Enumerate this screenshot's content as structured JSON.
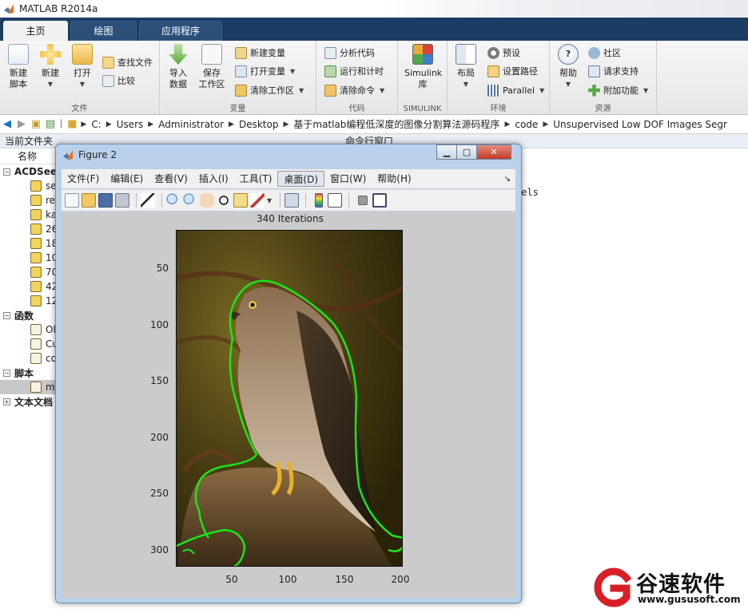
{
  "app": {
    "title": "MATLAB R2014a"
  },
  "tabs": [
    {
      "label": "主页"
    },
    {
      "label": "绘图"
    },
    {
      "label": "应用程序"
    }
  ],
  "ribbon": {
    "file_group": {
      "label": "文件",
      "new_script": "新建\n脚本",
      "new": "新建",
      "open": "打开",
      "find_files": "查找文件",
      "compare": "比较"
    },
    "variable_group": {
      "label": "变量",
      "import_data": "导入\n数据",
      "save_workspace": "保存\n工作区",
      "new_variable": "新建变量",
      "open_variable": "打开变量",
      "clear_workspace": "清除工作区"
    },
    "code_group": {
      "label": "代码",
      "analyze_code": "分析代码",
      "run_and_time": "运行和计时",
      "clear_commands": "清除命令"
    },
    "simulink_group": {
      "label": "SIMULINK",
      "simulink_library": "Simulink\n库"
    },
    "env_group": {
      "label": "环境",
      "layout": "布局",
      "preferences": "预设",
      "set_path": "设置路径",
      "parallel": "Parallel"
    },
    "resources_group": {
      "label": "资源",
      "help": "帮助",
      "community": "社区",
      "request_support": "请求支持",
      "add_ons": "附加功能"
    }
  },
  "address": {
    "crumbs": [
      "C:",
      "Users",
      "Administrator",
      "Desktop",
      "基于matlab编程低深度的图像分割算法源码程序",
      "code",
      "Unsupervised Low DOF Images Segr"
    ]
  },
  "current_folder": {
    "title": "当前文件夹",
    "column_name": "名称",
    "acdsee_group": "ACDSee",
    "acdsee_items": [
      "se",
      "re",
      "ka",
      "26",
      "18",
      "10",
      "70",
      "42",
      "12"
    ],
    "function_group": "函数",
    "function_items": [
      "Ol",
      "Cu",
      "co"
    ],
    "script_group": "脚本",
    "script_items": [
      "m"
    ],
    "text_group": "文本文档"
  },
  "command_window": {
    "title": "命令行窗口",
    "visible_text": "xels"
  },
  "figure": {
    "title": "Figure 2",
    "menus": [
      "文件(F)",
      "编辑(E)",
      "查看(V)",
      "插入(I)",
      "工具(T)",
      "桌面(D)",
      "窗口(W)",
      "帮助(H)"
    ],
    "active_menu_index": 5,
    "plot_title": "340 Iterations",
    "y_ticks": [
      "50",
      "100",
      "150",
      "200",
      "250",
      "300"
    ],
    "x_ticks": [
      "50",
      "100",
      "150",
      "200"
    ]
  },
  "watermark": {
    "brand": "谷速软件",
    "url": "www.gususoft.com"
  },
  "colors": {
    "tab_strip": "#1c3d63",
    "contour": "#19e619",
    "figure_frame": "#b9d1ea"
  }
}
